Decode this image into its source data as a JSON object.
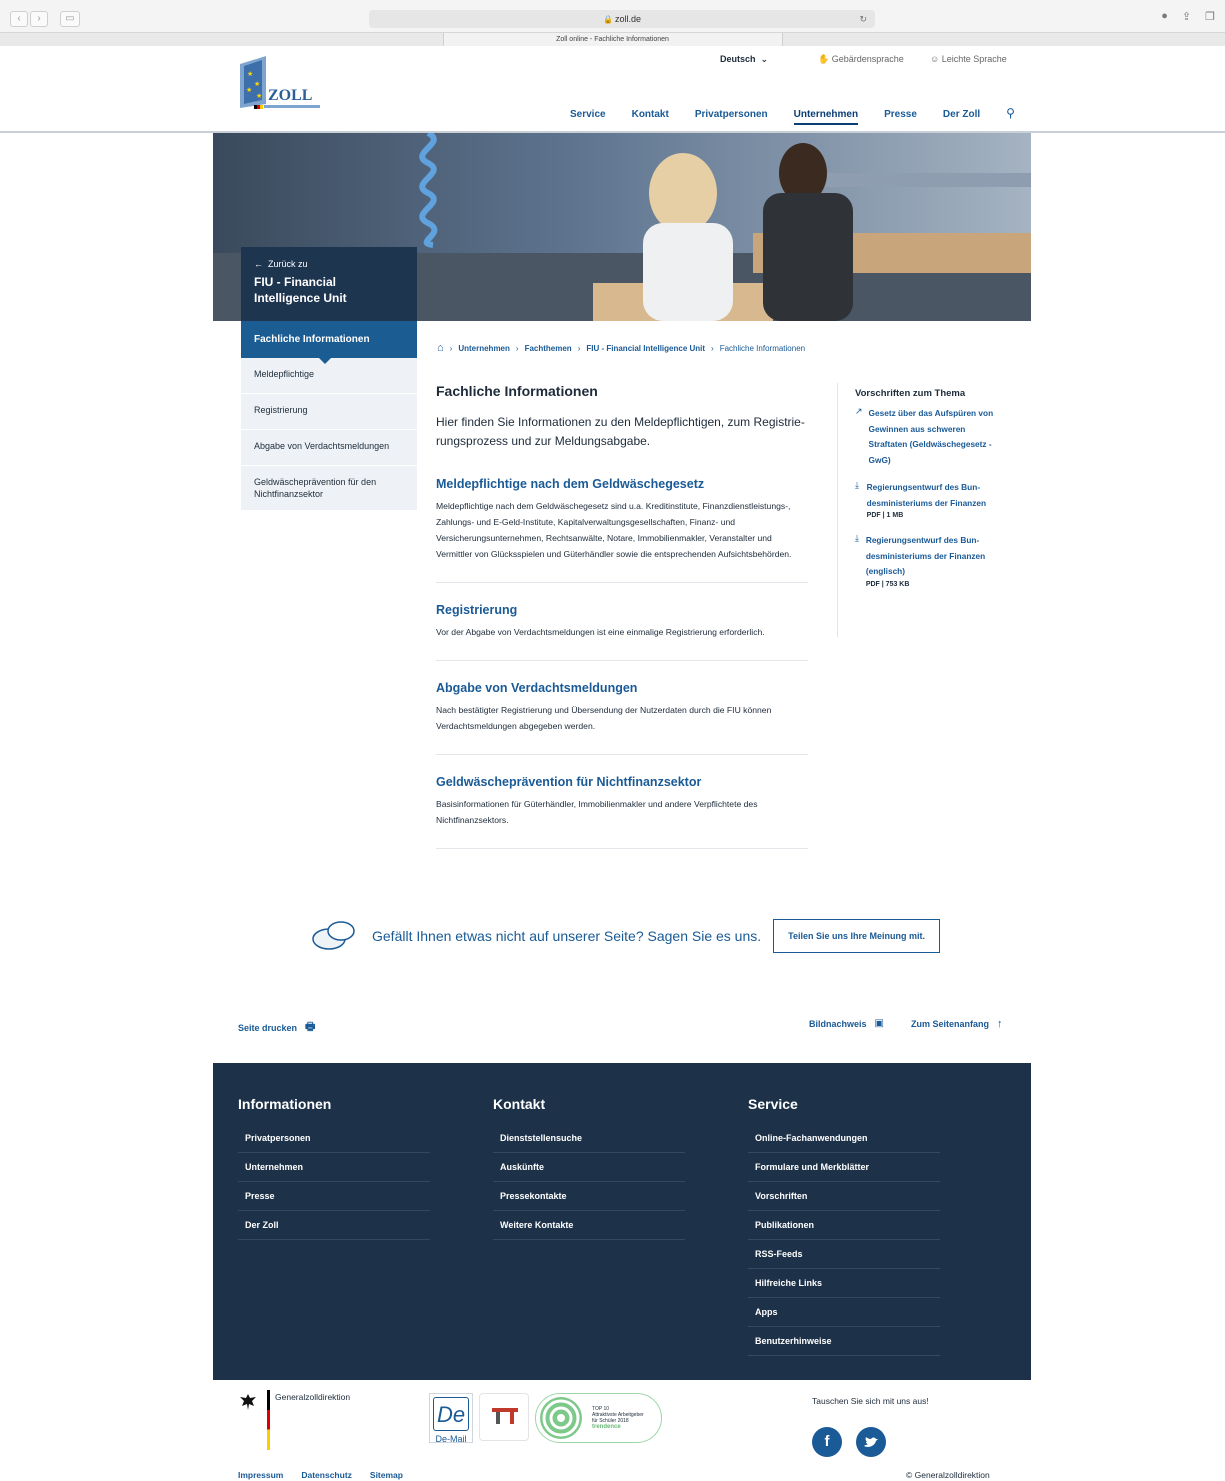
{
  "browser": {
    "url": "zoll.de",
    "tab_title": "Zoll online - Fachliche Informationen"
  },
  "header": {
    "logo_text": "ZOLL",
    "language": "Deutsch",
    "sign_language": "Gebärdensprache",
    "easy_language": "Leichte Sprache",
    "nav": [
      "Service",
      "Kontakt",
      "Privatpersonen",
      "Unternehmen",
      "Presse",
      "Der Zoll"
    ]
  },
  "hero": {
    "back_label": "Zurück zu",
    "section_title": "FIU - Financial Intelligence Unit"
  },
  "sidenav": {
    "active": "Fachliche Informationen",
    "items": [
      "Meldepflichtige",
      "Registrierung",
      "Abgabe von Verdachtsmeldungen",
      "Geldwäscheprävention für den Nichtfinanzsektor"
    ]
  },
  "breadcrumb": [
    "Unternehmen",
    "Fachthemen",
    "FIU - Financial Intelligence Unit",
    "Fachliche Informationen"
  ],
  "main": {
    "title": "Fachliche Informationen",
    "intro": "Hier finden Sie Informationen zu den Meldepflichtigen, zum Registrie­rungsprozess und zur Meldungsabgabe.",
    "sections": [
      {
        "title": "Meldepflichtige nach dem Geldwäschegesetz",
        "text": "Meldepflichtige nach dem Geldwäschegesetz sind u.a. Kreditinstitute, Finanzdienstleis­tungs-, Zahlungs- und E-Geld-Institute, Kapitalverwaltungsgesellschaften, Finanz- und Versicherungsunternehmen, Rechtsanwälte, Notare, Immobilienmakler, Veranstalter und Vermittler von Glücksspielen und Güterhändler sowie die entsprechenden Aufsichtsbehörden."
      },
      {
        "title": "Registrierung",
        "text": "Vor der Abgabe von Verdachtsmeldungen ist eine einmalige Registrierung erforderlich."
      },
      {
        "title": "Abgabe von Verdachtsmeldungen",
        "text": "Nach bestätigter Registrierung und Übersendung der Nutzerdaten durch die FIU können Verdachtsmeldungen abgegeben werden."
      },
      {
        "title": "Geldwäscheprävention für Nichtfinanzsektor",
        "text": "Basisinformationen für Güterhändler, Immobilienmakler und andere Verpflichtete des Nichtfinanzsektors."
      }
    ]
  },
  "aside": {
    "title": "Vorschriften zum Thema",
    "links": [
      {
        "icon": "external-link-icon",
        "text": "Gesetz über das Aufspüren von Gewinnen aus schweren Straftaten (Geldwäsche­gesetz - GwG)",
        "meta": ""
      },
      {
        "icon": "download-icon",
        "text": "Regierungsentwurf des Bun­desministeriums der Finanzen",
        "meta": "PDF | 1 MB"
      },
      {
        "icon": "download-icon",
        "text": "Regierungsentwurf des Bun­desministeriums der Finan­zen (englisch)",
        "meta": "PDF | 753 KB"
      }
    ]
  },
  "feedback": {
    "message": "Gefällt Ihnen etwas nicht auf unserer Seite? Sagen Sie es uns.",
    "button": "Teilen Sie uns Ihre Meinung mit."
  },
  "utility": {
    "print": "Seite drucken",
    "credits": "Bildnachweis",
    "top": "Zum Seitenanfang"
  },
  "footer": {
    "columns": [
      {
        "title": "Informationen",
        "items": [
          "Privatpersonen",
          "Unternehmen",
          "Presse",
          "Der Zoll"
        ]
      },
      {
        "title": "Kontakt",
        "items": [
          "Dienststellensuche",
          "Auskünfte",
          "Pressekontakte",
          "Weitere Kontakte"
        ]
      },
      {
        "title": "Service",
        "items": [
          "Online-Fachanwendungen",
          "Formulare und Merkblätter",
          "Vorschriften",
          "Publikationen",
          "RSS-Feeds",
          "Hilfreiche Links",
          "Apps",
          "Benutzerhinweise"
        ]
      }
    ]
  },
  "bottom": {
    "authority": "Generalzolldirektion",
    "demail": "De-Mail",
    "badge_top": "TOP 10",
    "badge_line1": "Attraktivste Arbeitgeber",
    "badge_line2": "für Schüler 2018",
    "badge_brand": "trendence",
    "social_title": "Tauschen Sie sich mit uns aus!",
    "facebook": "f",
    "legal": [
      "Impressum",
      "Datenschutz",
      "Sitemap"
    ],
    "copyright": "© Generalzolldirektion"
  }
}
